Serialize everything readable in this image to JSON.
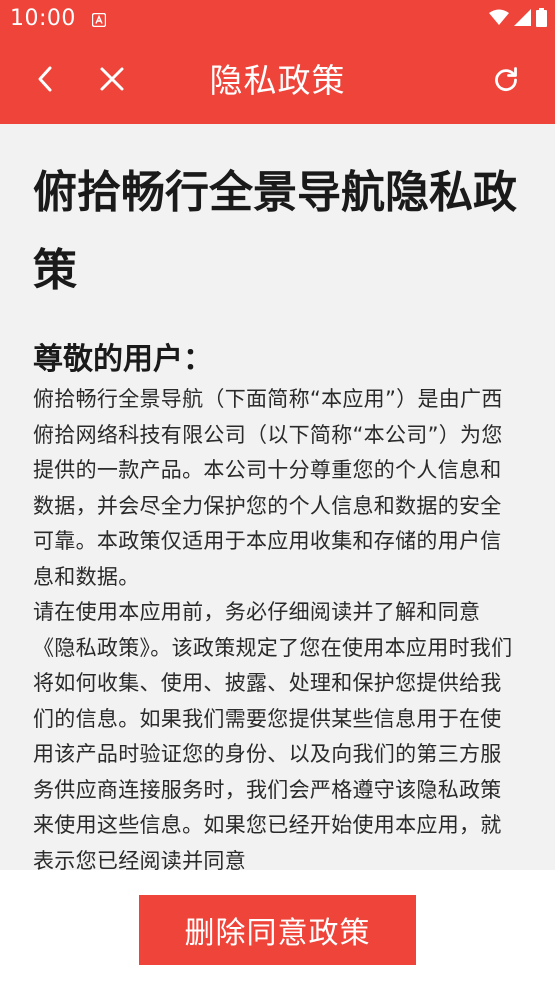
{
  "status_bar": {
    "time": "10:00",
    "notification_icon": "a-badge-icon",
    "icons": [
      "wifi-icon",
      "signal-icon",
      "battery-icon"
    ]
  },
  "app_bar": {
    "title": "隐私政策",
    "back_icon": "chevron-left-icon",
    "close_icon": "close-icon",
    "refresh_icon": "refresh-icon",
    "background_color": "#ef443a"
  },
  "document": {
    "title": "俯拾畅行全景导航隐私政策",
    "greeting": "尊敬的用户：",
    "paragraphs": [
      "俯拾畅行全景导航（下面简称“本应用”）是由广西俯拾网络科技有限公司（以下简称“本公司”）为您提供的一款产品。本公司十分尊重您的个人信息和数据，并会尽全力保护您的个人信息和数据的安全可靠。本政策仅适用于本应用收集和存储的用户信息和数据。",
      "请在使用本应用前，务必仔细阅读并了解和同意《隐私政策》。该政策规定了您在使用本应用时我们将如何收集、使用、披露、处理和保护您提供给我们的信息。如果我们需要您提供某些信息用于在使用该产品时验证您的身份、以及向我们的第三方服务供应商连接服务时，我们会严格遵守该隐私政策来使用这些信息。如果您已经开始使用本应用，就表示您已经阅读并同意"
    ]
  },
  "bottom": {
    "delete_consent_label": "删除同意政策"
  }
}
